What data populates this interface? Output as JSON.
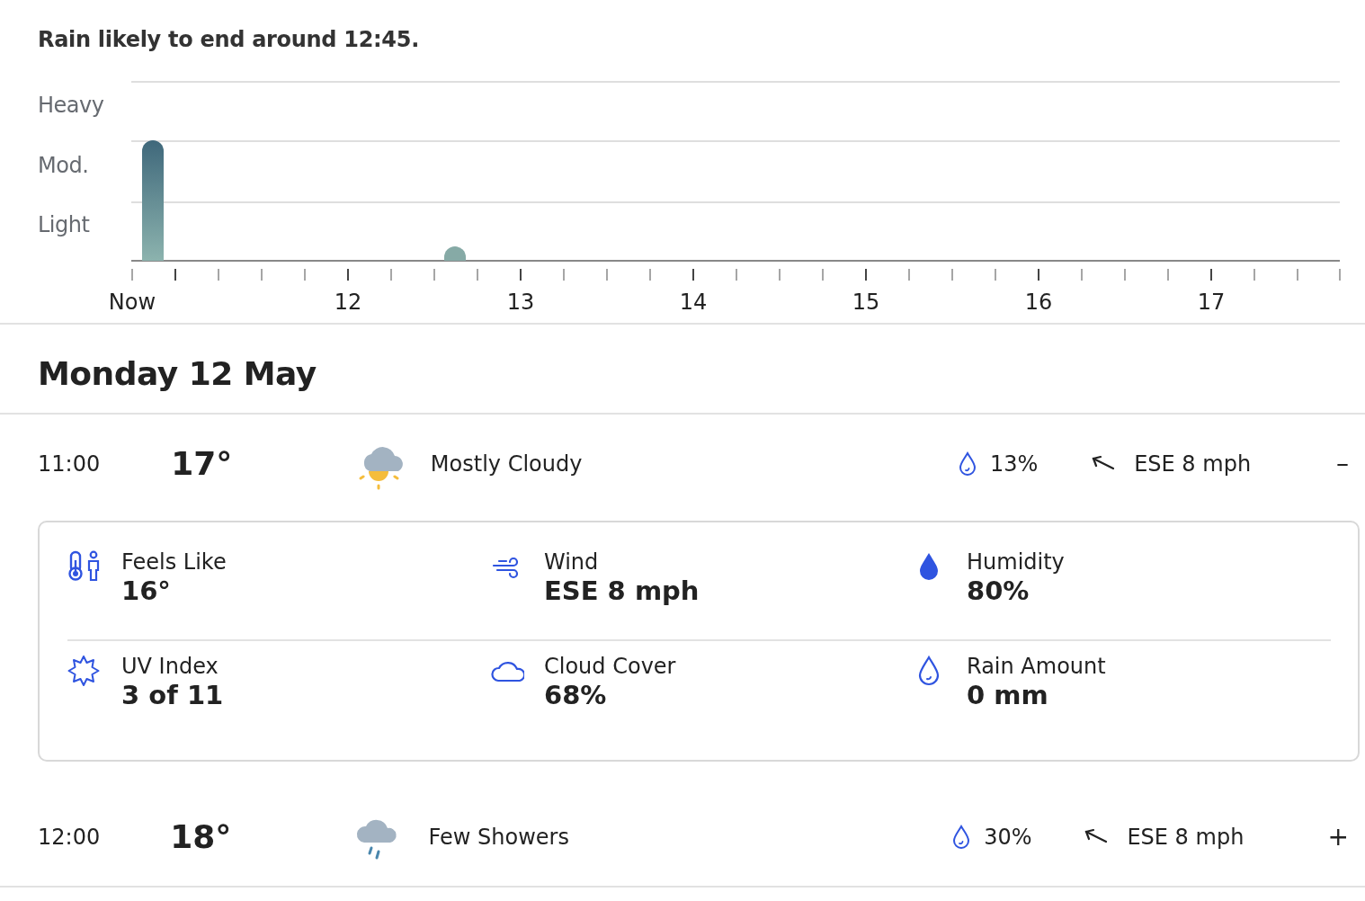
{
  "rain_summary": "Rain likely to end around 12:45.",
  "rain_chart": {
    "intensity_labels": [
      "Heavy",
      "Mod.",
      "Light"
    ],
    "time_labels": [
      "Now",
      "12",
      "13",
      "14",
      "15",
      "16",
      "17"
    ]
  },
  "day_heading": "Monday 12 May",
  "hours": [
    {
      "time": "11:00",
      "temperature": "17°",
      "kind": "sun-cloud",
      "condition": "Mostly Cloudy",
      "rain_chance": "13%",
      "wind": "ESE 8 mph",
      "toggle": "–",
      "details": [
        {
          "kind": "feels",
          "label": "Feels Like",
          "value": "16°"
        },
        {
          "kind": "wind",
          "label": "Wind",
          "value": "ESE 8 mph"
        },
        {
          "kind": "humidity",
          "label": "Humidity",
          "value": "80%"
        },
        {
          "kind": "uv",
          "label": "UV Index",
          "value": "3 of 11"
        },
        {
          "kind": "cloud",
          "label": "Cloud Cover",
          "value": "68%"
        },
        {
          "kind": "rain",
          "label": "Rain Amount",
          "value": "0 mm"
        }
      ]
    },
    {
      "time": "12:00",
      "temperature": "18°",
      "kind": "rain-cloud",
      "condition": "Few Showers",
      "rain_chance": "30%",
      "wind": "ESE 8 mph",
      "toggle": "+"
    }
  ]
}
